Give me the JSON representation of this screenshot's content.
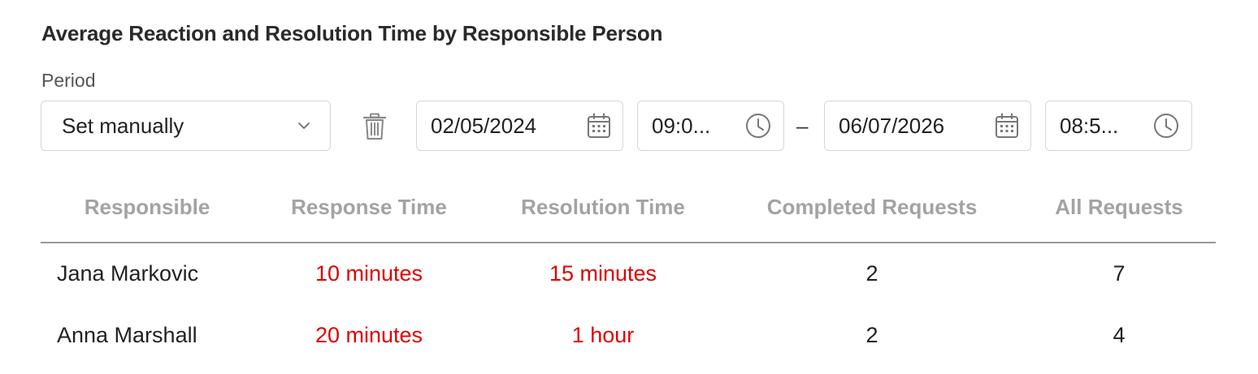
{
  "page": {
    "title": "Average Reaction and Resolution Time by Responsible Person"
  },
  "filter": {
    "period_label": "Period",
    "period_value": "Set manually",
    "start_date": "02/05/2024",
    "start_time": "09:0...",
    "separator": "–",
    "end_date": "06/07/2026",
    "end_time": "08:5...",
    "icons": {
      "dropdown": "chevron-down-icon",
      "clear": "trash-icon",
      "date": "calendar-icon",
      "time": "clock-icon"
    }
  },
  "table": {
    "headers": [
      "Responsible",
      "Response Time",
      "Resolution Time",
      "Completed Requests",
      "All Requests"
    ],
    "rows": [
      [
        "Jana Markovic",
        "10 minutes",
        "15 minutes",
        "2",
        "7"
      ],
      [
        "Anna Marshall",
        "20 minutes",
        "1 hour",
        "2",
        "4"
      ]
    ]
  },
  "colors": {
    "header_text": "#a3a3a3",
    "time_value": "#e00000",
    "border": "#d6d6d6"
  }
}
